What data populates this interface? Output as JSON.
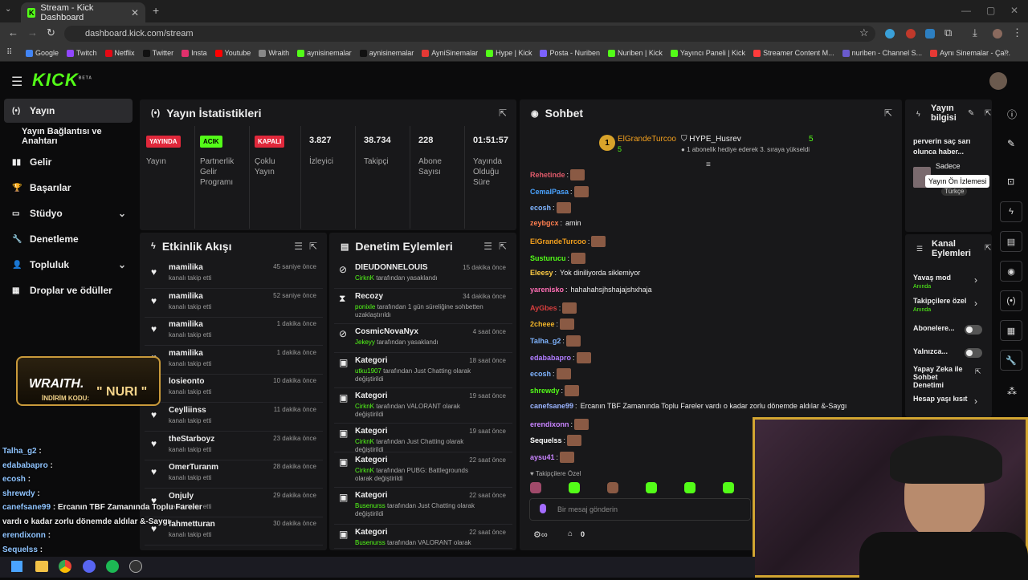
{
  "browser": {
    "tab_title": "Stream - Kick Dashboard",
    "url": "dashboard.kick.com/stream",
    "bookmarks": [
      "Google",
      "Twitch",
      "Netflix",
      "Twitter",
      "Insta",
      "Youtube",
      "Wraith",
      "aynisinemalar",
      "aynisinemalar",
      "AyniSinemalar",
      "Hype | Kick",
      "Posta - Nuriben",
      "Nuriben | Kick",
      "Yayıncı Paneli | Kick",
      "Streamer Content M...",
      "nuriben - Channel S...",
      "Aynı Sinemalar - Ça..."
    ]
  },
  "brand": {
    "logo": "KICK",
    "beta": "BETA"
  },
  "sidebar": {
    "items": [
      {
        "label": "Yayın"
      },
      {
        "label": "Yayın Bağlantısı ve Anahtarı"
      },
      {
        "label": "Gelir"
      },
      {
        "label": "Başarılar"
      },
      {
        "label": "Stüdyo"
      },
      {
        "label": "Denetleme"
      },
      {
        "label": "Topluluk"
      },
      {
        "label": "Droplar ve ödüller"
      }
    ]
  },
  "stats": {
    "title": "Yayın İstatistikleri",
    "cols": [
      {
        "badge": "YAYINDA",
        "label": "Yayın"
      },
      {
        "badge": "ACIK",
        "label": "Partnerlik Gelir Programı"
      },
      {
        "badge": "KAPALI",
        "label": "Çoklu Yayın"
      },
      {
        "value": "3.827",
        "label": "İzleyici"
      },
      {
        "value": "38.734",
        "label": "Takipçi"
      },
      {
        "value": "228",
        "label": "Abone Sayısı"
      },
      {
        "value": "01:51:57",
        "label": "Yayında Olduğu Süre"
      }
    ]
  },
  "activity": {
    "title": "Etkinlik Akışı",
    "sub": "kanalı takip etti",
    "items": [
      {
        "name": "mamilika",
        "time": "45 saniye önce"
      },
      {
        "name": "mamilika",
        "time": "52 saniye önce"
      },
      {
        "name": "mamilika",
        "time": "1 dakika önce"
      },
      {
        "name": "mamilika",
        "time": "1 dakika önce"
      },
      {
        "name": "losieonto",
        "time": "10 dakika önce"
      },
      {
        "name": "Ceylliinss",
        "time": "11 dakika önce"
      },
      {
        "name": "theStarboyz",
        "time": "23 dakika önce"
      },
      {
        "name": "OmerTuranm",
        "time": "28 dakika önce"
      },
      {
        "name": "Onjuly",
        "time": "29 dakika önce"
      },
      {
        "name": "fahmetturan",
        "time": "30 dakika önce"
      }
    ]
  },
  "modactions": {
    "title": "Denetim Eylemleri",
    "items": [
      {
        "name": "DIEUDONNELOUIS",
        "time": "15 dakika önce",
        "actor": "CirknK",
        "rest": " tarafından yasaklandı"
      },
      {
        "name": "Recozy",
        "time": "34 dakika önce",
        "actor": "ponixle",
        "rest": " tarafından 1 gün süreliğine sohbetten uzaklaştırıldı"
      },
      {
        "name": "CosmicNovaNyx",
        "time": "4 saat önce",
        "actor": "Jekeyy",
        "rest": " tarafından yasaklandı"
      },
      {
        "name": "Kategori",
        "time": "18 saat önce",
        "actor": "utku1907",
        "rest": " tarafından Just Chatting olarak değiştirildi"
      },
      {
        "name": "Kategori",
        "time": "19 saat önce",
        "actor": "CirknK",
        "rest": " tarafından VALORANT olarak değiştirildi"
      },
      {
        "name": "Kategori",
        "time": "19 saat önce",
        "actor": "CirknK",
        "rest": " tarafından Just Chatting olarak değiştirildi"
      },
      {
        "name": "Kategori",
        "time": "22 saat önce",
        "actor": "CirknK",
        "rest": " tarafından PUBG: Battlegrounds olarak değiştirildi"
      },
      {
        "name": "Kategori",
        "time": "22 saat önce",
        "actor": "Busenurss",
        "rest": " tarafından Just Chatting olarak değiştirildi"
      },
      {
        "name": "Kategori",
        "time": "22 saat önce",
        "actor": "Busenurss",
        "rest": " tarafından VALORANT olarak"
      }
    ]
  },
  "chat": {
    "title": "Sohbet",
    "pinned_user": "ElGrandeTurcoo",
    "pinned_count": "5",
    "hype_user": "HYPE_Husrev",
    "hype_count": "5",
    "hype_msg": "1 abonelik hediye ederek 3. sıraya yükseldi",
    "lines": [
      {
        "user": "Rehetinde",
        "color": "#e05a6a",
        "msg": ""
      },
      {
        "user": "CemalPasa",
        "color": "#4aa3ff",
        "msg": ""
      },
      {
        "user": "ecosh",
        "color": "#7fb4ff",
        "msg": ""
      },
      {
        "user": "zeybgcx",
        "color": "#ff7f50",
        "msg": "amin"
      },
      {
        "user": "ElGrandeTurcoo",
        "color": "#f3a01e",
        "msg": ""
      },
      {
        "user": "Susturucu",
        "color": "#53fc18",
        "msg": ""
      },
      {
        "user": "Eleesy",
        "color": "#ffcc44",
        "msg": "Yok diniliyorda siklemiyor"
      },
      {
        "user": "yarenisko",
        "color": "#ff6eb4",
        "msg": "hahahahsjhshajajshxhaja"
      },
      {
        "user": "AyGbes",
        "color": "#d83e3e",
        "msg": ""
      },
      {
        "user": "2cheee",
        "color": "#f0b429",
        "msg": ""
      },
      {
        "user": "Talha_g2",
        "color": "#7fb4ff",
        "msg": ""
      },
      {
        "user": "edababapro",
        "color": "#b07cff",
        "msg": ""
      },
      {
        "user": "ecosh",
        "color": "#7fb4ff",
        "msg": ""
      },
      {
        "user": "shrewdy",
        "color": "#53fc18",
        "msg": ""
      },
      {
        "user": "canefsane99",
        "color": "#9ab4ff",
        "msg": "Ercanın TBF Zamanında Toplu Fareler vardı o kadar zorlu dönemde aldılar &-Saygı"
      },
      {
        "user": "erendixonn",
        "color": "#c984ff",
        "msg": ""
      },
      {
        "user": "Sequelss",
        "color": "#ffffff",
        "msg": ""
      },
      {
        "user": "aysu41",
        "color": "#c984ff",
        "msg": ""
      }
    ],
    "followers_only": "Takipçilere Özel",
    "placeholder": "Bir mesaj gönderin",
    "count": "0"
  },
  "info": {
    "title": "Yayın bilgisi",
    "desc": "perverin saç sarı olunca haber...",
    "lang_label": "Sadece",
    "lang": "Türkçe",
    "tooltip": "Yayın Ön İzlemesi"
  },
  "channel": {
    "title": "Kanal Eylemleri",
    "items": [
      {
        "label": "Yavaş mod",
        "sub": "Anında"
      },
      {
        "label": "Takipçilere özel",
        "sub": "Anında"
      },
      {
        "label": "Abonelere..."
      },
      {
        "label": "Yalnızca..."
      },
      {
        "label": "Yapay Zeka ile Sohbet Denetimi"
      },
      {
        "label": "Hesap yaşı kısıt"
      }
    ]
  },
  "overlay": {
    "promo_brand": "WRAITH.",
    "promo_label": "İNDİRİM KODU:",
    "promo_code": "\" NURI \"",
    "chat": [
      {
        "user": "Talha_g2",
        "msg": ":"
      },
      {
        "user": "edababapro",
        "msg": ":"
      },
      {
        "user": "ecosh",
        "msg": ":"
      },
      {
        "user": "shrewdy",
        "msg": ":"
      },
      {
        "user": "canefsane99",
        "msg": ": Ercanın TBF Zamanında Toplu Fareler"
      },
      {
        "user": "",
        "msg": "vardı o kadar zorlu dönemde aldılar &-Saygı"
      },
      {
        "user": "erendixonn",
        "msg": ":"
      },
      {
        "user": "Sequelss",
        "msg": ":"
      },
      {
        "user": "aysu41",
        "msg": ":"
      }
    ]
  }
}
